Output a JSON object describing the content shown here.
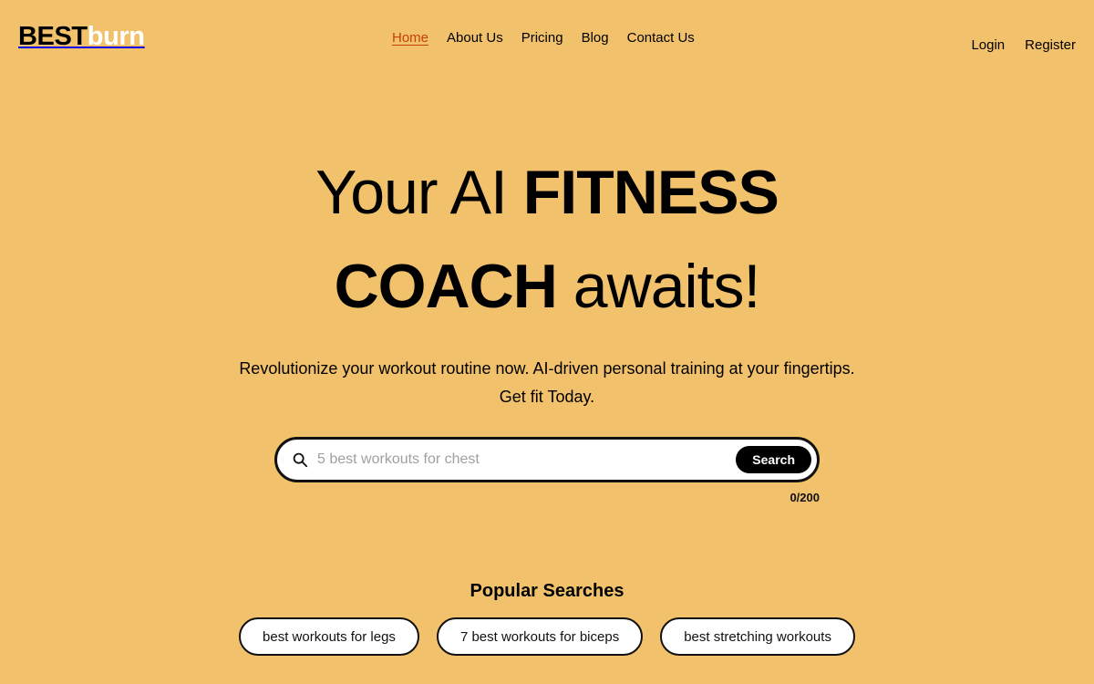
{
  "brand": {
    "name_part1": "BEST",
    "name_part2": "burn"
  },
  "header": {
    "nav": [
      {
        "label": "Home",
        "active": true
      },
      {
        "label": "About Us",
        "active": false
      },
      {
        "label": "Pricing",
        "active": false
      },
      {
        "label": "Blog",
        "active": false
      },
      {
        "label": "Contact Us",
        "active": false
      }
    ],
    "auth": [
      {
        "label": "Login"
      },
      {
        "label": "Register"
      }
    ],
    "active_link_color": "#c2410c"
  },
  "hero": {
    "title_line1_normal": "Your AI ",
    "title_line1_bold": "FITNESS",
    "title_line2_bold": "COACH",
    "title_line2_normal": " awaits!",
    "subtitle_line1": "Revolutionize your workout routine now. AI-driven personal training at your fingertips.",
    "subtitle_line2": "Get fit Today."
  },
  "search": {
    "icon": "search-icon",
    "value": "",
    "placeholder": "5 best workouts for chest",
    "button_label": "Search",
    "counter": "0/200",
    "max_length": 200
  },
  "popular": {
    "title": "Popular Searches",
    "chips": [
      {
        "label": "best workouts for legs"
      },
      {
        "label": "7 best workouts for biceps"
      },
      {
        "label": "best stretching workouts"
      }
    ]
  },
  "theme": {
    "background": "#f2c16b",
    "accent": "#c2410c",
    "ink": "#000000",
    "surface": "#ffffff"
  }
}
